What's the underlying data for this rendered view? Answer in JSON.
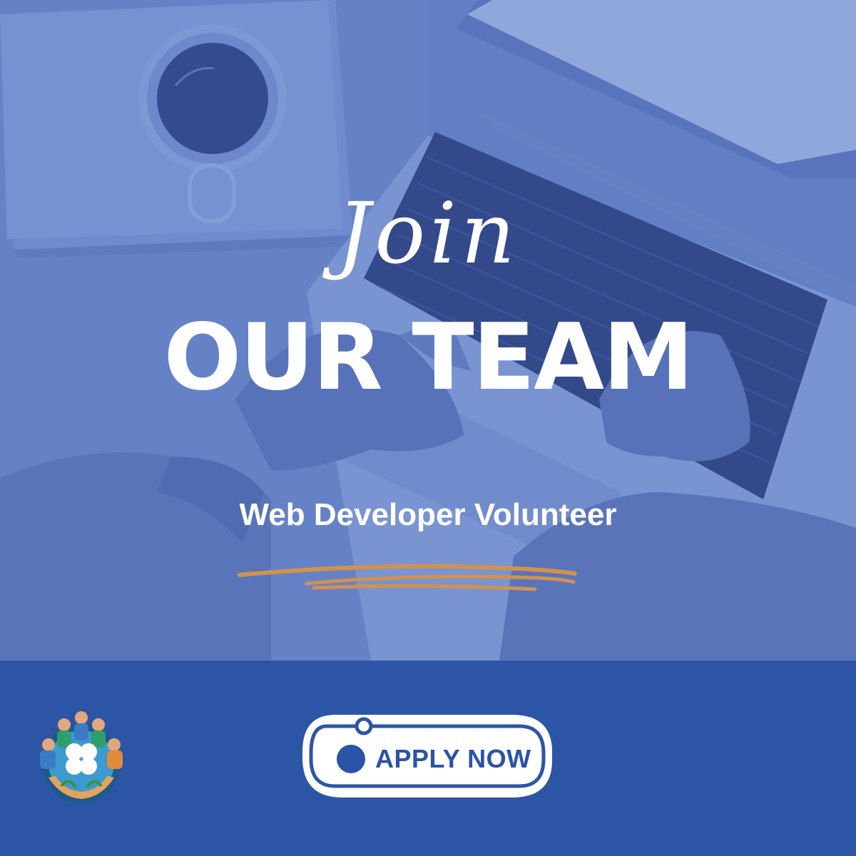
{
  "hero": {
    "script_word": "Join",
    "headline": "OUR TEAM",
    "role": "Web Developer Volunteer"
  },
  "cta": {
    "label": "APPLY NOW",
    "icon": "chevron-right-circle-icon"
  },
  "logo": {
    "icon": "community-clover-logo"
  },
  "colors": {
    "overlay_blue": "#5b79c2",
    "band_blue": "#2d55a6",
    "accent_orange": "#d1924f",
    "text_white": "#ffffff",
    "button_white": "#ffffff",
    "button_text": "#2b53a6"
  }
}
